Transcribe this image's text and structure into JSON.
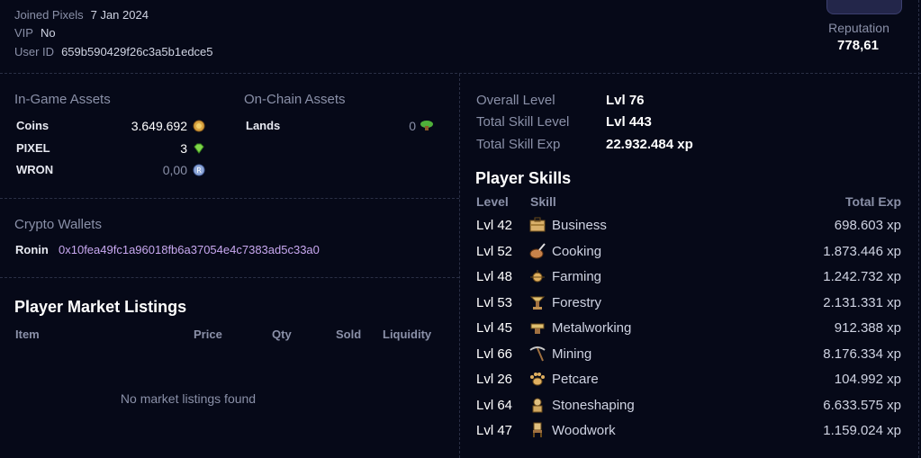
{
  "profile": {
    "joined_label": "Joined Pixels",
    "joined_value": "7 Jan 2024",
    "vip_label": "VIP",
    "vip_value": "No",
    "userid_label": "User ID",
    "userid_value": "659b590429f26c3a5b1edce5",
    "reputation_label": "Reputation",
    "reputation_value": "778,61"
  },
  "ingame": {
    "title": "In-Game Assets",
    "items": [
      {
        "name": "Coins",
        "value": "3.649.692",
        "icon": "coin-icon"
      },
      {
        "name": "PIXEL",
        "value": "3",
        "icon": "gem-icon"
      },
      {
        "name": "WRON",
        "value": "0,00",
        "icon": "ron-icon"
      }
    ]
  },
  "onchain": {
    "title": "On-Chain Assets",
    "items": [
      {
        "name": "Lands",
        "value": "0",
        "icon": "land-icon"
      }
    ]
  },
  "wallets": {
    "title": "Crypto Wallets",
    "label": "Ronin",
    "address": "0x10fea49fc1a96018fb6a37054e4c7383ad5c33a0"
  },
  "market": {
    "title": "Player Market Listings",
    "columns": [
      "Item",
      "Price",
      "Qty",
      "Sold",
      "Liquidity"
    ],
    "empty": "No market listings found"
  },
  "levels": [
    {
      "label": "Overall Level",
      "value": "Lvl 76"
    },
    {
      "label": "Total Skill Level",
      "value": "Lvl 443"
    },
    {
      "label": "Total Skill Exp",
      "value": "22.932.484 xp"
    }
  ],
  "skills": {
    "title": "Player Skills",
    "col_level": "Level",
    "col_skill": "Skill",
    "col_exp": "Total Exp",
    "rows": [
      {
        "level": "Lvl 42",
        "name": "Business",
        "xp": "698.603 xp",
        "icon": "business-icon"
      },
      {
        "level": "Lvl 52",
        "name": "Cooking",
        "xp": "1.873.446 xp",
        "icon": "cooking-icon"
      },
      {
        "level": "Lvl 48",
        "name": "Farming",
        "xp": "1.242.732 xp",
        "icon": "farming-icon"
      },
      {
        "level": "Lvl 53",
        "name": "Forestry",
        "xp": "2.131.331 xp",
        "icon": "forestry-icon"
      },
      {
        "level": "Lvl 45",
        "name": "Metalworking",
        "xp": "912.388 xp",
        "icon": "metalworking-icon"
      },
      {
        "level": "Lvl 66",
        "name": "Mining",
        "xp": "8.176.334 xp",
        "icon": "mining-icon"
      },
      {
        "level": "Lvl 26",
        "name": "Petcare",
        "xp": "104.992 xp",
        "icon": "petcare-icon"
      },
      {
        "level": "Lvl 64",
        "name": "Stoneshaping",
        "xp": "6.633.575 xp",
        "icon": "stoneshaping-icon"
      },
      {
        "level": "Lvl 47",
        "name": "Woodwork",
        "xp": "1.159.024 xp",
        "icon": "woodwork-icon"
      }
    ]
  }
}
